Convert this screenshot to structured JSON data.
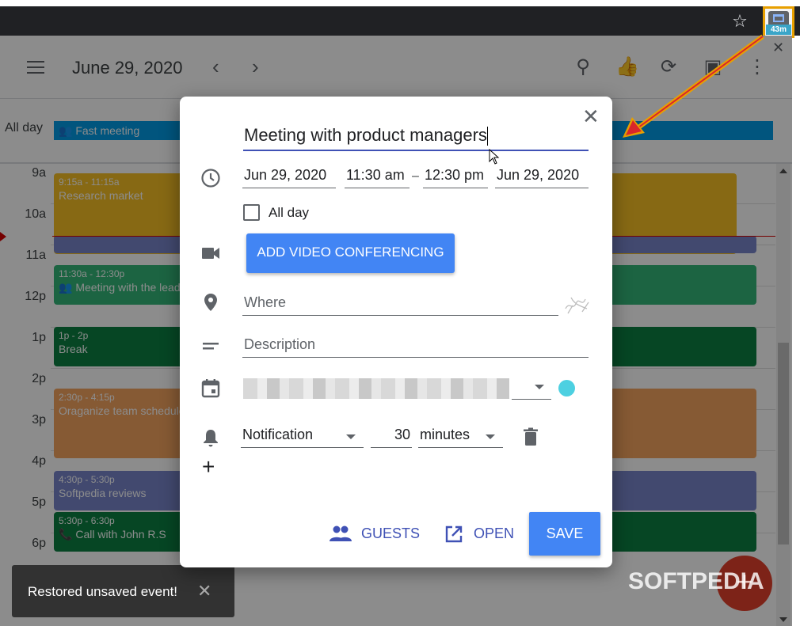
{
  "browser": {
    "extension_badge": "43m",
    "star_icon": "star-outline-icon"
  },
  "app": {
    "current_date": "June 29, 2020",
    "prev_label": "‹",
    "next_label": "›",
    "allday_label": "All day",
    "allday_event": "Fast meeting",
    "hours": [
      "9a",
      "10a",
      "11a",
      "12p",
      "1p",
      "2p",
      "3p",
      "4p",
      "5p",
      "6p"
    ],
    "events": [
      {
        "time": "9:15a - 11:15a",
        "title": "Research market",
        "color": "#f6bf26"
      },
      {
        "time": "11:30a - 12:30p",
        "title": "Meeting with the lead",
        "color": "#33b679"
      },
      {
        "time": "1p - 2p",
        "title": "Break",
        "color": "#0b8043"
      },
      {
        "time": "2:30p - 4:15p",
        "title": "Oraganize team schedule",
        "color": "#f4a460"
      },
      {
        "time": "4:30p - 5:30p",
        "title": "Softpedia reviews",
        "color": "#7986cb"
      },
      {
        "time": "5:30p - 6:30p",
        "title": "Call with John R.S",
        "color": "#0b8043"
      }
    ]
  },
  "snackbar": {
    "message": "Restored unsaved event!",
    "close_label": "✕"
  },
  "watermark": "SOFTPEDIA",
  "fab_label": "+",
  "dialog": {
    "close_label": "✕",
    "title_value": "Meeting with product managers",
    "start_date": "Jun 29, 2020",
    "start_time": "11:30 am",
    "separator": "–",
    "end_time": "12:30 pm",
    "end_date": "Jun 29, 2020",
    "allday_label": "All day",
    "video_button": "ADD VIDEO CONFERENCING",
    "where_placeholder": "Where",
    "description_placeholder": "Description",
    "calendar_color": "#4dd0e1",
    "notification_type": "Notification",
    "notification_amount": "30",
    "notification_unit": "minutes",
    "guests_label": "GUESTS",
    "open_label": "OPEN",
    "save_label": "SAVE"
  },
  "colors": {
    "primary": "#4285f4",
    "accent": "#3f51b5",
    "allday_event": "#039be5",
    "annotation": "#e8a000"
  }
}
